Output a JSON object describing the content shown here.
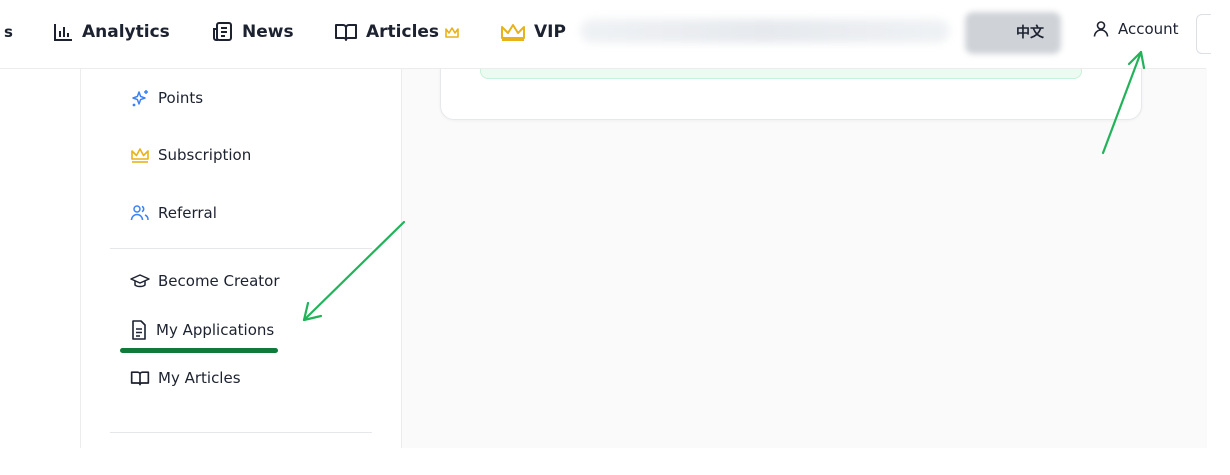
{
  "nav": {
    "cut_label": "s",
    "analytics": "Analytics",
    "news": "News",
    "articles": "Articles",
    "vip": "VIP",
    "lang": "中文",
    "account": "Account"
  },
  "sidebar": {
    "items": [
      {
        "label": "Points"
      },
      {
        "label": "Subscription"
      },
      {
        "label": "Referral"
      },
      {
        "label": "Become Creator"
      },
      {
        "label": "My Applications"
      },
      {
        "label": "My Articles"
      }
    ]
  },
  "colors": {
    "crown": "#e8b21a",
    "blue_icon": "#3b82f6",
    "arrow": "#22b35a",
    "highlight": "#0f7a3a"
  }
}
